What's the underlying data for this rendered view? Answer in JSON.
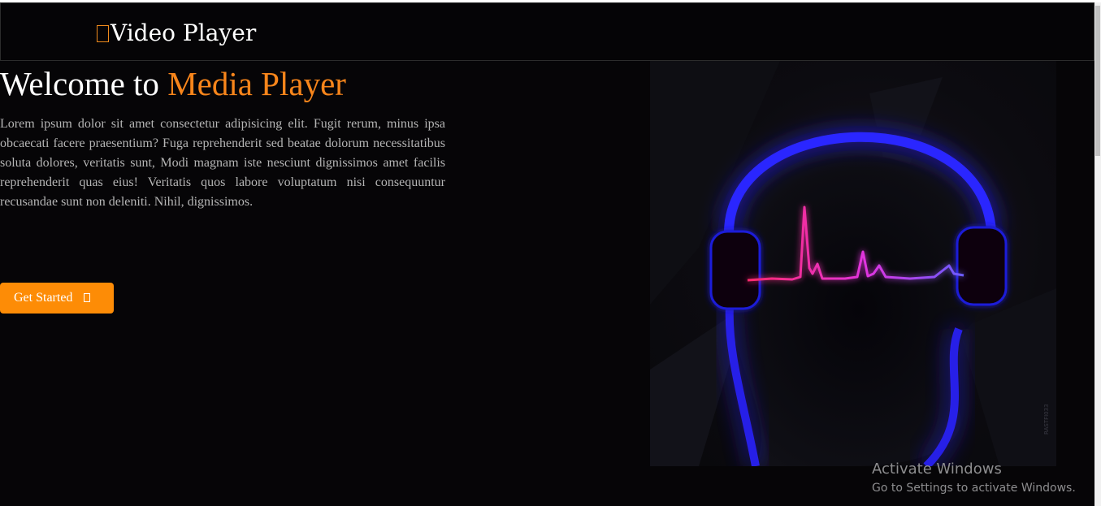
{
  "navbar": {
    "brand_icon": "media-play-icon",
    "brand_text": "Video Player"
  },
  "hero": {
    "title_lead": "Welcome to ",
    "title_accent": "Media Player",
    "paragraph": "Lorem ipsum dolor sit amet consectetur adipisicing elit. Fugit rerum, minus ipsa obcaecati facere praesentium? Fuga reprehenderit sed beatae dolorum necessitatibus soluta dolores, veritatis sunt, Modi magnam iste nesciunt dignissimos amet facilis reprehenderit quas eius! Veritatis quos labore voluptatum nisi consequuntur recusandae sunt non deleniti. Nihil, dignissimos.",
    "cta_label": "Get Started",
    "cta_icon": "arrow-right-icon",
    "image": "headphones-heartbeat-illustration"
  },
  "watermark": {
    "title": "Activate Windows",
    "subtitle": "Go to Settings to activate Windows."
  },
  "colors": {
    "background": "#060507",
    "accent": "#f7851b",
    "button": "#fd8c06",
    "text_muted": "#b5b5b5"
  }
}
